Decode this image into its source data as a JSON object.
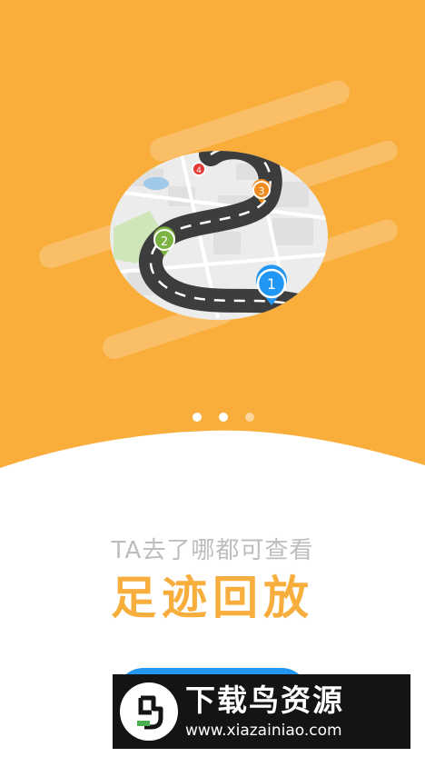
{
  "colors": {
    "header_bg": "#f9ad3b",
    "title": "#f7ae3c",
    "subtitle": "#bdbdbd",
    "button": "#2196f3"
  },
  "illustration": {
    "markers": [
      "1",
      "2",
      "3",
      "4"
    ]
  },
  "pager": {
    "count": 3,
    "active_index": 0
  },
  "content": {
    "subtitle": "TA去了哪都可查看",
    "title": "足迹回放"
  },
  "watermark": {
    "name": "下载鸟资源",
    "url": "www.xiazainiao.com"
  }
}
